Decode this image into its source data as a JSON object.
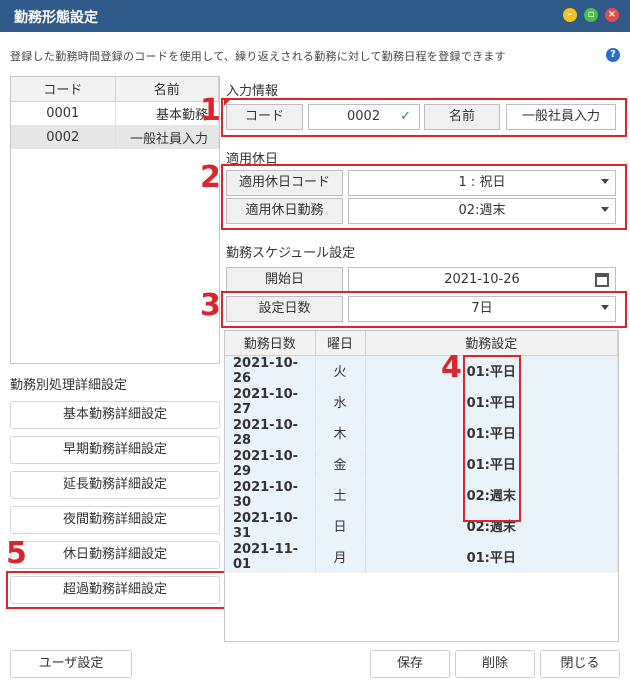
{
  "window": {
    "title": "勤務形態設定"
  },
  "description": "登録した勤務時間登録のコードを使用して、繰り返えされる勤務に対して勤務日程を登録できます",
  "left_list": {
    "columns": [
      "コード",
      "名前"
    ],
    "rows": [
      {
        "code": "0001",
        "name": "基本勤務",
        "selected": false
      },
      {
        "code": "0002",
        "name": "一般社員入力",
        "selected": true
      }
    ]
  },
  "detail_section": {
    "title": "勤務別処理詳細設定",
    "buttons": [
      "基本勤務詳細設定",
      "早期勤務詳細設定",
      "延長勤務詳細設定",
      "夜間勤務詳細設定",
      "休日勤務詳細設定",
      "超過勤務詳細設定"
    ]
  },
  "input_info": {
    "title": "入力情報",
    "code_label": "コード",
    "code_value": "0002",
    "name_label": "名前",
    "name_value": "一般社員入力"
  },
  "holiday": {
    "title": "適用休日",
    "code_label": "適用休日コード",
    "code_value": "1 : 祝日",
    "work_label": "適用休日勤務",
    "work_value": "02:週末"
  },
  "schedule": {
    "title": "勤務スケジュール設定",
    "start_label": "開始日",
    "start_value": "2021-10-26",
    "days_label": "設定日数",
    "days_value": "7日",
    "columns": [
      "勤務日数",
      "曜日",
      "勤務設定"
    ],
    "rows": [
      {
        "date": "2021-10-26",
        "weekday": "火",
        "setting": "01:平日"
      },
      {
        "date": "2021-10-27",
        "weekday": "水",
        "setting": "01:平日"
      },
      {
        "date": "2021-10-28",
        "weekday": "木",
        "setting": "01:平日"
      },
      {
        "date": "2021-10-29",
        "weekday": "金",
        "setting": "01:平日"
      },
      {
        "date": "2021-10-30",
        "weekday": "土",
        "setting": "02:週末"
      },
      {
        "date": "2021-10-31",
        "weekday": "日",
        "setting": "02:週末"
      },
      {
        "date": "2021-11-01",
        "weekday": "月",
        "setting": "01:平日"
      }
    ]
  },
  "footer": {
    "user_settings": "ユーザ設定",
    "save": "保存",
    "delete": "削除",
    "close": "閉じる"
  },
  "annotations": [
    "1",
    "2",
    "3",
    "4",
    "5"
  ],
  "colors": {
    "titlebar": "#2f5a8a",
    "highlight": "#d9262c",
    "check": "#2e8b57"
  }
}
